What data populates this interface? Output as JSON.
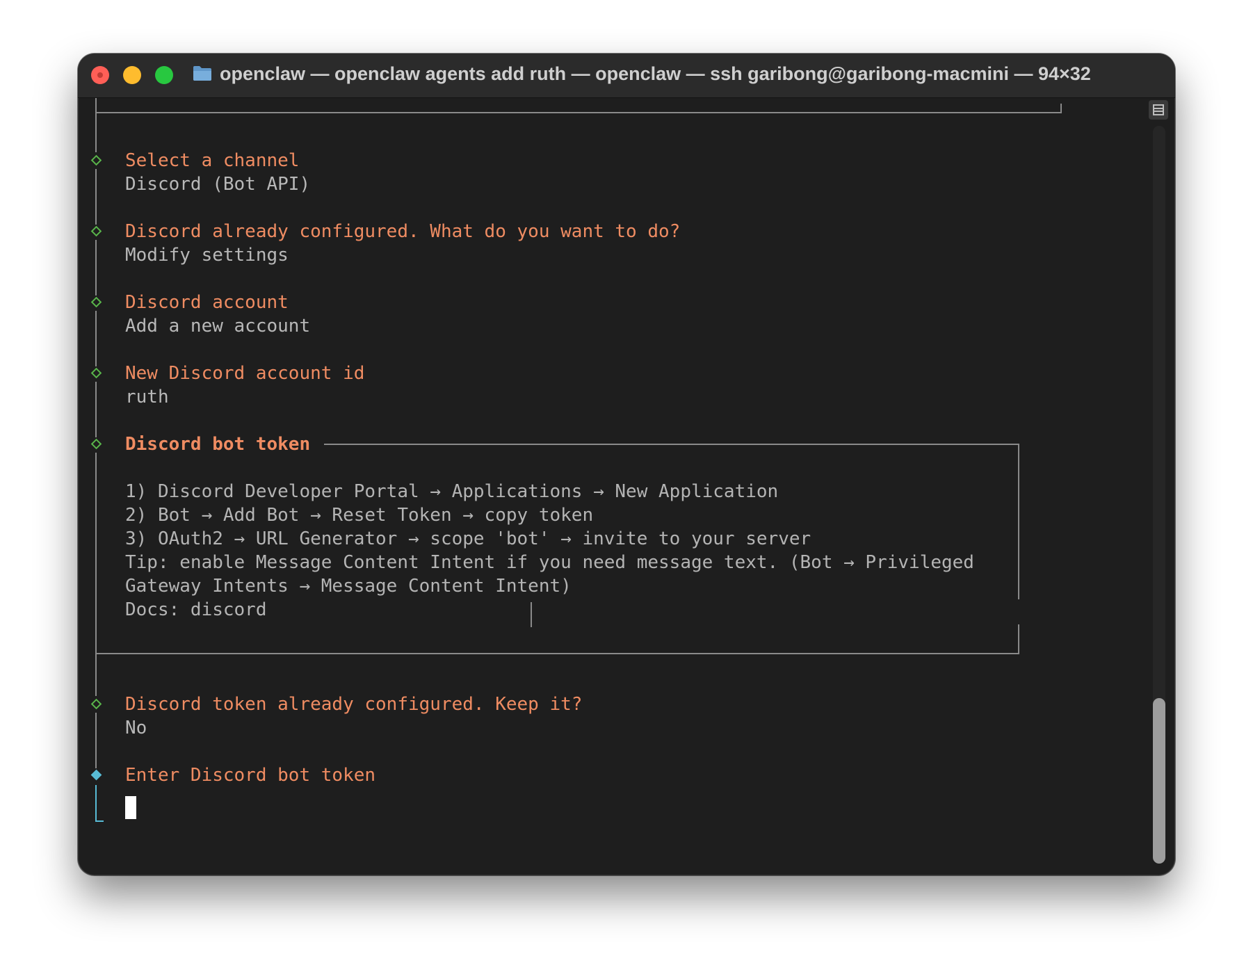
{
  "window": {
    "title": "openclaw — openclaw agents add ruth — openclaw — ssh garibong@garibong-macmini — 94×32",
    "traffic_lights": [
      "close",
      "minimize",
      "zoom"
    ]
  },
  "terminal": {
    "steps": [
      {
        "prompt": "Select a channel",
        "answer": "Discord (Bot API)"
      },
      {
        "prompt": "Discord already configured. What do you want to do?",
        "answer": "Modify settings"
      },
      {
        "prompt": "Discord account",
        "answer": "Add a new account"
      },
      {
        "prompt": "New Discord account id",
        "answer": "ruth"
      }
    ],
    "note": {
      "title": "Discord bot token",
      "lines": [
        "1) Discord Developer Portal → Applications → New Application",
        "2) Bot → Add Bot → Reset Token → copy token",
        "3) OAuth2 → URL Generator → scope 'bot' → invite to your server",
        "Tip: enable Message Content Intent if you need message text. (Bot → Privileged",
        "Gateway Intents → Message Content Intent)",
        "Docs: discord"
      ]
    },
    "after": [
      {
        "prompt": "Discord token already configured. Keep it?",
        "answer": "No"
      }
    ],
    "active": {
      "prompt": "Enter Discord bot token",
      "value": ""
    }
  },
  "colors": {
    "prompt": "#ef8c62",
    "answer": "#b8b8b8",
    "done_marker": "#59b54a",
    "active_marker": "#58bcd6",
    "background": "#1e1e1e"
  },
  "icons": {
    "folder": "folder-icon",
    "done_step": "hollow-diamond-icon",
    "active_step": "filled-diamond-icon",
    "scroll": "scroll-button-icon"
  }
}
